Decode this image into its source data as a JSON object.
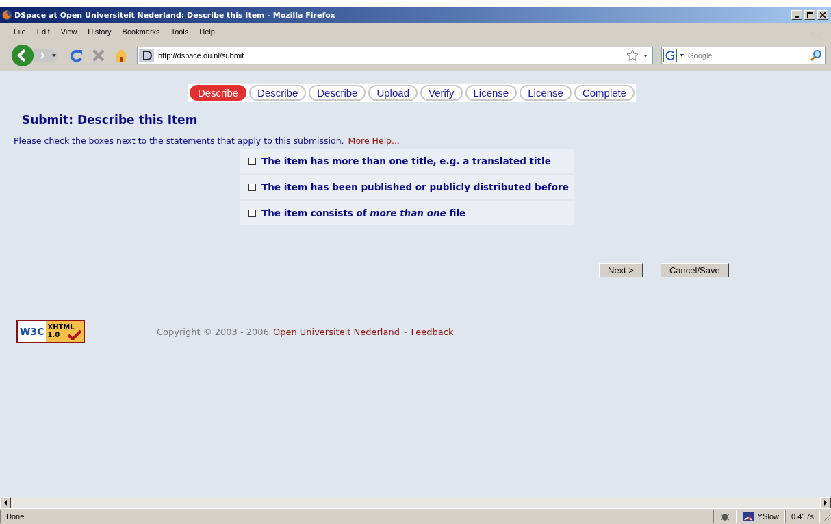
{
  "window": {
    "title": "DSpace at Open Universiteit Nederland: Describe this Item - Mozilla Firefox"
  },
  "menu": [
    "File",
    "Edit",
    "View",
    "History",
    "Bookmarks",
    "Tools",
    "Help"
  ],
  "address": {
    "value": "http://dspace.ou.nl/submit"
  },
  "search": {
    "placeholder": "Google"
  },
  "steps": [
    {
      "label": "Describe",
      "selected": true
    },
    {
      "label": "Describe",
      "selected": false
    },
    {
      "label": "Describe",
      "selected": false
    },
    {
      "label": "Upload",
      "selected": false
    },
    {
      "label": "Verify",
      "selected": false
    },
    {
      "label": "License",
      "selected": false
    },
    {
      "label": "License",
      "selected": false
    },
    {
      "label": "Complete",
      "selected": false
    }
  ],
  "heading": "Submit: Describe this Item",
  "instruction": "Please check the boxes next to the statements that apply to this submission.",
  "help_link": "More Help...",
  "options": [
    {
      "label": "The item has more than one title, e.g. a translated title",
      "checked": false
    },
    {
      "label": "The item has been published or publicly distributed before",
      "checked": false
    },
    {
      "label": "The item consists of *more than one* file",
      "checked": false
    }
  ],
  "buttons": [
    "Next >",
    "Cancel/Save"
  ],
  "footer": {
    "badge_left": "W3C",
    "badge_right": "XHTML 1.0",
    "copyright": "Copyright © 2003 - 2006",
    "org_link": "Open Universiteit Nederland",
    "separator": "-",
    "feedback_link": "Feedback"
  },
  "status_bar": {
    "text": "Done",
    "yslow": "YSlow",
    "time": "0.417s"
  }
}
